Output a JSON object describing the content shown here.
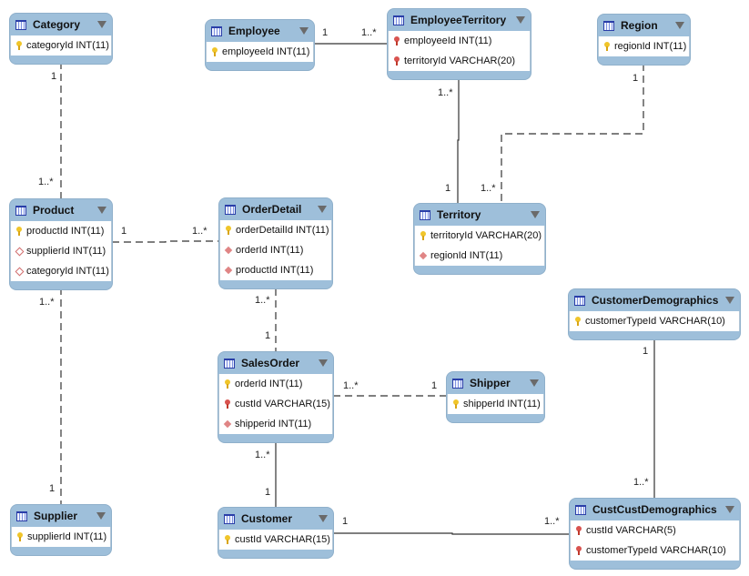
{
  "diagram": {
    "type": "entity-relationship",
    "colors": {
      "header": "#9ebfda",
      "body": "#ffffff",
      "line": "#333333"
    },
    "tables": [
      {
        "id": "Category",
        "title": "Category",
        "columns": [
          {
            "name": "categoryId INT(11)",
            "key": "pk"
          }
        ]
      },
      {
        "id": "Employee",
        "title": "Employee",
        "columns": [
          {
            "name": "employeeId INT(11)",
            "key": "pk"
          }
        ]
      },
      {
        "id": "EmployeeTerritory",
        "title": "EmployeeTerritory",
        "columns": [
          {
            "name": "employeeId INT(11)",
            "key": "pk-fk"
          },
          {
            "name": "territoryId VARCHAR(20)",
            "key": "pk-fk"
          }
        ]
      },
      {
        "id": "Region",
        "title": "Region",
        "columns": [
          {
            "name": "regionId INT(11)",
            "key": "pk"
          }
        ]
      },
      {
        "id": "Product",
        "title": "Product",
        "columns": [
          {
            "name": "productId INT(11)",
            "key": "pk"
          },
          {
            "name": "supplierId INT(11)",
            "key": "index"
          },
          {
            "name": "categoryId INT(11)",
            "key": "index"
          }
        ]
      },
      {
        "id": "OrderDetail",
        "title": "OrderDetail",
        "columns": [
          {
            "name": "orderDetailId INT(11)",
            "key": "pk"
          },
          {
            "name": "orderId INT(11)",
            "key": "fk"
          },
          {
            "name": "productId INT(11)",
            "key": "fk"
          }
        ]
      },
      {
        "id": "Territory",
        "title": "Territory",
        "columns": [
          {
            "name": "territoryId VARCHAR(20)",
            "key": "pk"
          },
          {
            "name": "regionId INT(11)",
            "key": "fk"
          }
        ]
      },
      {
        "id": "CustomerDemographics",
        "title": "CustomerDemographics",
        "columns": [
          {
            "name": "customerTypeId VARCHAR(10)",
            "key": "pk"
          }
        ]
      },
      {
        "id": "SalesOrder",
        "title": "SalesOrder",
        "columns": [
          {
            "name": "orderId INT(11)",
            "key": "pk"
          },
          {
            "name": "custId VARCHAR(15)",
            "key": "pk-fk"
          },
          {
            "name": "shipperid INT(11)",
            "key": "fk"
          }
        ]
      },
      {
        "id": "Shipper",
        "title": "Shipper",
        "columns": [
          {
            "name": "shipperId INT(11)",
            "key": "pk"
          }
        ]
      },
      {
        "id": "Supplier",
        "title": "Supplier",
        "columns": [
          {
            "name": "supplierId INT(11)",
            "key": "pk"
          }
        ]
      },
      {
        "id": "Customer",
        "title": "Customer",
        "columns": [
          {
            "name": "custId VARCHAR(15)",
            "key": "pk"
          }
        ]
      },
      {
        "id": "CustCustDemographics",
        "title": "CustCustDemographics",
        "columns": [
          {
            "name": "custId VARCHAR(5)",
            "key": "pk-fk"
          },
          {
            "name": "customerTypeId VARCHAR(10)",
            "key": "pk-fk"
          }
        ]
      }
    ],
    "relationships": [
      {
        "from": "Category",
        "to": "Product",
        "from_card": "1",
        "to_card": "1..*",
        "style": "dashed"
      },
      {
        "from": "Employee",
        "to": "EmployeeTerritory",
        "from_card": "1",
        "to_card": "1..*",
        "style": "solid"
      },
      {
        "from": "EmployeeTerritory",
        "to": "Territory",
        "from_card": "1..*",
        "to_card": "1",
        "style": "solid"
      },
      {
        "from": "Region",
        "to": "Territory",
        "from_card": "1",
        "to_card": "1..*",
        "style": "dashed"
      },
      {
        "from": "Product",
        "to": "OrderDetail",
        "from_card": "1",
        "to_card": "1..*",
        "style": "dashed"
      },
      {
        "from": "OrderDetail",
        "to": "SalesOrder",
        "from_card": "1..*",
        "to_card": "1",
        "style": "dashed"
      },
      {
        "from": "Product",
        "to": "Supplier",
        "from_card": "1..*",
        "to_card": "1",
        "style": "dashed"
      },
      {
        "from": "SalesOrder",
        "to": "Shipper",
        "from_card": "1..*",
        "to_card": "1",
        "style": "dashed"
      },
      {
        "from": "SalesOrder",
        "to": "Customer",
        "from_card": "1..*",
        "to_card": "1",
        "style": "solid"
      },
      {
        "from": "Customer",
        "to": "CustCustDemographics",
        "from_card": "1",
        "to_card": "1..*",
        "style": "solid"
      },
      {
        "from": "CustomerDemographics",
        "to": "CustCustDemographics",
        "from_card": "1",
        "to_card": "1..*",
        "style": "solid"
      }
    ]
  }
}
